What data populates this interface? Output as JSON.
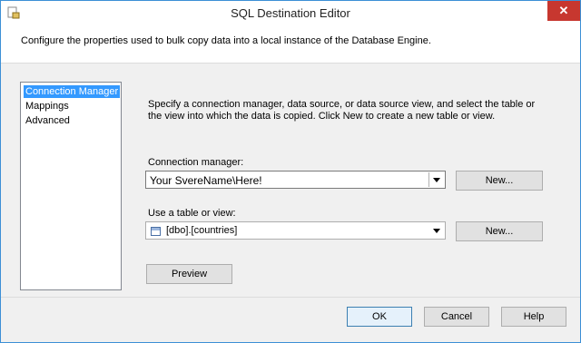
{
  "window": {
    "title": "SQL Destination Editor",
    "close_glyph": "✕",
    "description": "Configure the properties used to bulk copy data into a local instance of the Database Engine."
  },
  "nav": {
    "items": [
      {
        "label": "Connection Manager",
        "selected": true
      },
      {
        "label": "Mappings",
        "selected": false
      },
      {
        "label": "Advanced",
        "selected": false
      }
    ]
  },
  "main": {
    "instructions": "Specify a connection manager, data source, or data source view, and select the table or the view into which the data is copied. Click New to create a new table or view.",
    "connection_manager_label": "Connection manager:",
    "connection_manager_value": "Your SvereName\\Here!",
    "table_label": "Use a table or view:",
    "table_value": "[dbo].[countries]",
    "new_label": "New...",
    "preview_label": "Preview"
  },
  "footer": {
    "ok_label": "OK",
    "cancel_label": "Cancel",
    "help_label": "Help"
  },
  "colors": {
    "selection": "#3399ff",
    "close_button": "#c7372f",
    "window_border": "#3c8fd6"
  }
}
